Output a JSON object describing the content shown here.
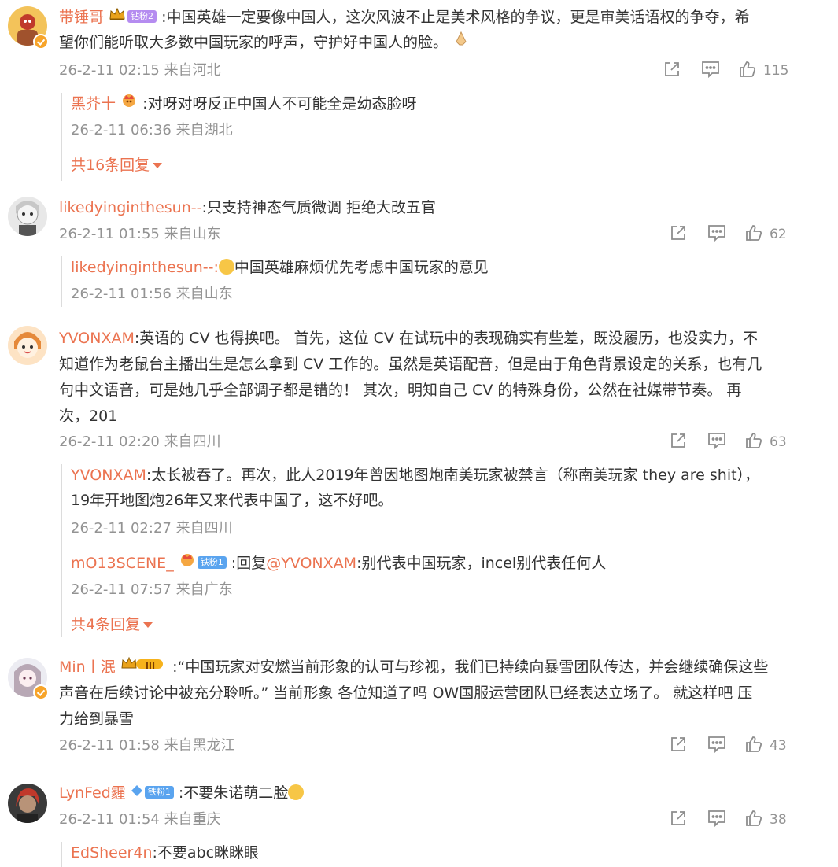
{
  "colors": {
    "username": "#eb7350",
    "meta": "#939393",
    "text": "#333333",
    "divider": "#dcdcdc",
    "vip_badge": "#f7a42a"
  },
  "comments": [
    {
      "user": "带锤哥",
      "badge": "钻粉2",
      "lines": [
        ":中国英雄一定要像中国人，这次风波不止是美术风格的争议，更是审美话语权的争夺，希",
        "望你们能听取大多数中国玩家的呼声，守护好中国人的脸。"
      ],
      "time": "26-2-11 02:15 来自河北",
      "likes": "115",
      "replies": [
        {
          "user": "黑芥十",
          "text": ":对呀对呀反正中国人不可能全是幼态脸呀",
          "time": "26-2-11 06:36 来自湖北"
        }
      ],
      "more": "共16条回复"
    },
    {
      "user": "likedyinginthesun--",
      "lines": [
        ":只支持神态气质微调  拒绝大改五官"
      ],
      "time": "26-2-11 01:55 来自山东",
      "likes": "62",
      "replies": [
        {
          "user": "likedyinginthesun--",
          "text": "中国英雄麻烦优先考虑中国玩家的意见",
          "time": "26-2-11 01:56 来自山东"
        }
      ]
    },
    {
      "user": "YVONXAM",
      "lines": [
        ":英语的 CV 也得换吧。  首先，这位 CV 在试玩中的表现确实有些差，既没履历，也没实力，不",
        "知道作为老鼠台主播出生是怎么拿到 CV 工作的。虽然是英语配音，但是由于角色背景设定的关系，也有几",
        "句中文语音，可是她几乎全部调子都是错的！  其次，明知自己 CV 的特殊身份，公然在社媒带节奏。  再",
        "次，201"
      ],
      "time": "26-2-11 02:20 来自四川",
      "likes": "63",
      "replies": [
        {
          "user": "YVONXAM",
          "text": ":太长被吞了。再次，此人2019年曾因地图炮南美玩家被禁言（称南美玩家 they are shit），",
          "text2": "19年开地图炮26年又来代表中国了，这不好吧。",
          "time": "26-2-11 02:27 来自四川"
        },
        {
          "user": "mO13SCENE_",
          "badge": "铁粉1",
          "text": ":回复",
          "mention": "@YVONXAM",
          "text_after": ":别代表中国玩家，incel别代表任何人",
          "time": "26-2-11 07:57 来自广东"
        }
      ],
      "more": "共4条回复"
    },
    {
      "user": "Min丨泯",
      "badge": "III",
      "lines": [
        ":“中国玩家对安燃当前形象的认可与珍视，我们已持续向暴雪团队传达，并会继续确保这些",
        "声音在后续讨论中被充分聆听。” 当前形象 各位知道了吗 OW国服运营团队已经表达立场了。 就这样吧 压",
        "力给到暴雪"
      ],
      "time": "26-2-11 01:58 来自黑龙江",
      "likes": "43"
    },
    {
      "user": "LynFed霾",
      "badge": "铁粉1",
      "lines": [
        ":不要朱诺萌二脸"
      ],
      "time": "26-2-11 01:54 来自重庆",
      "likes": "38",
      "replies": [
        {
          "user": "EdSheer4n",
          "text": ":不要abc眯眯眼"
        }
      ]
    }
  ]
}
